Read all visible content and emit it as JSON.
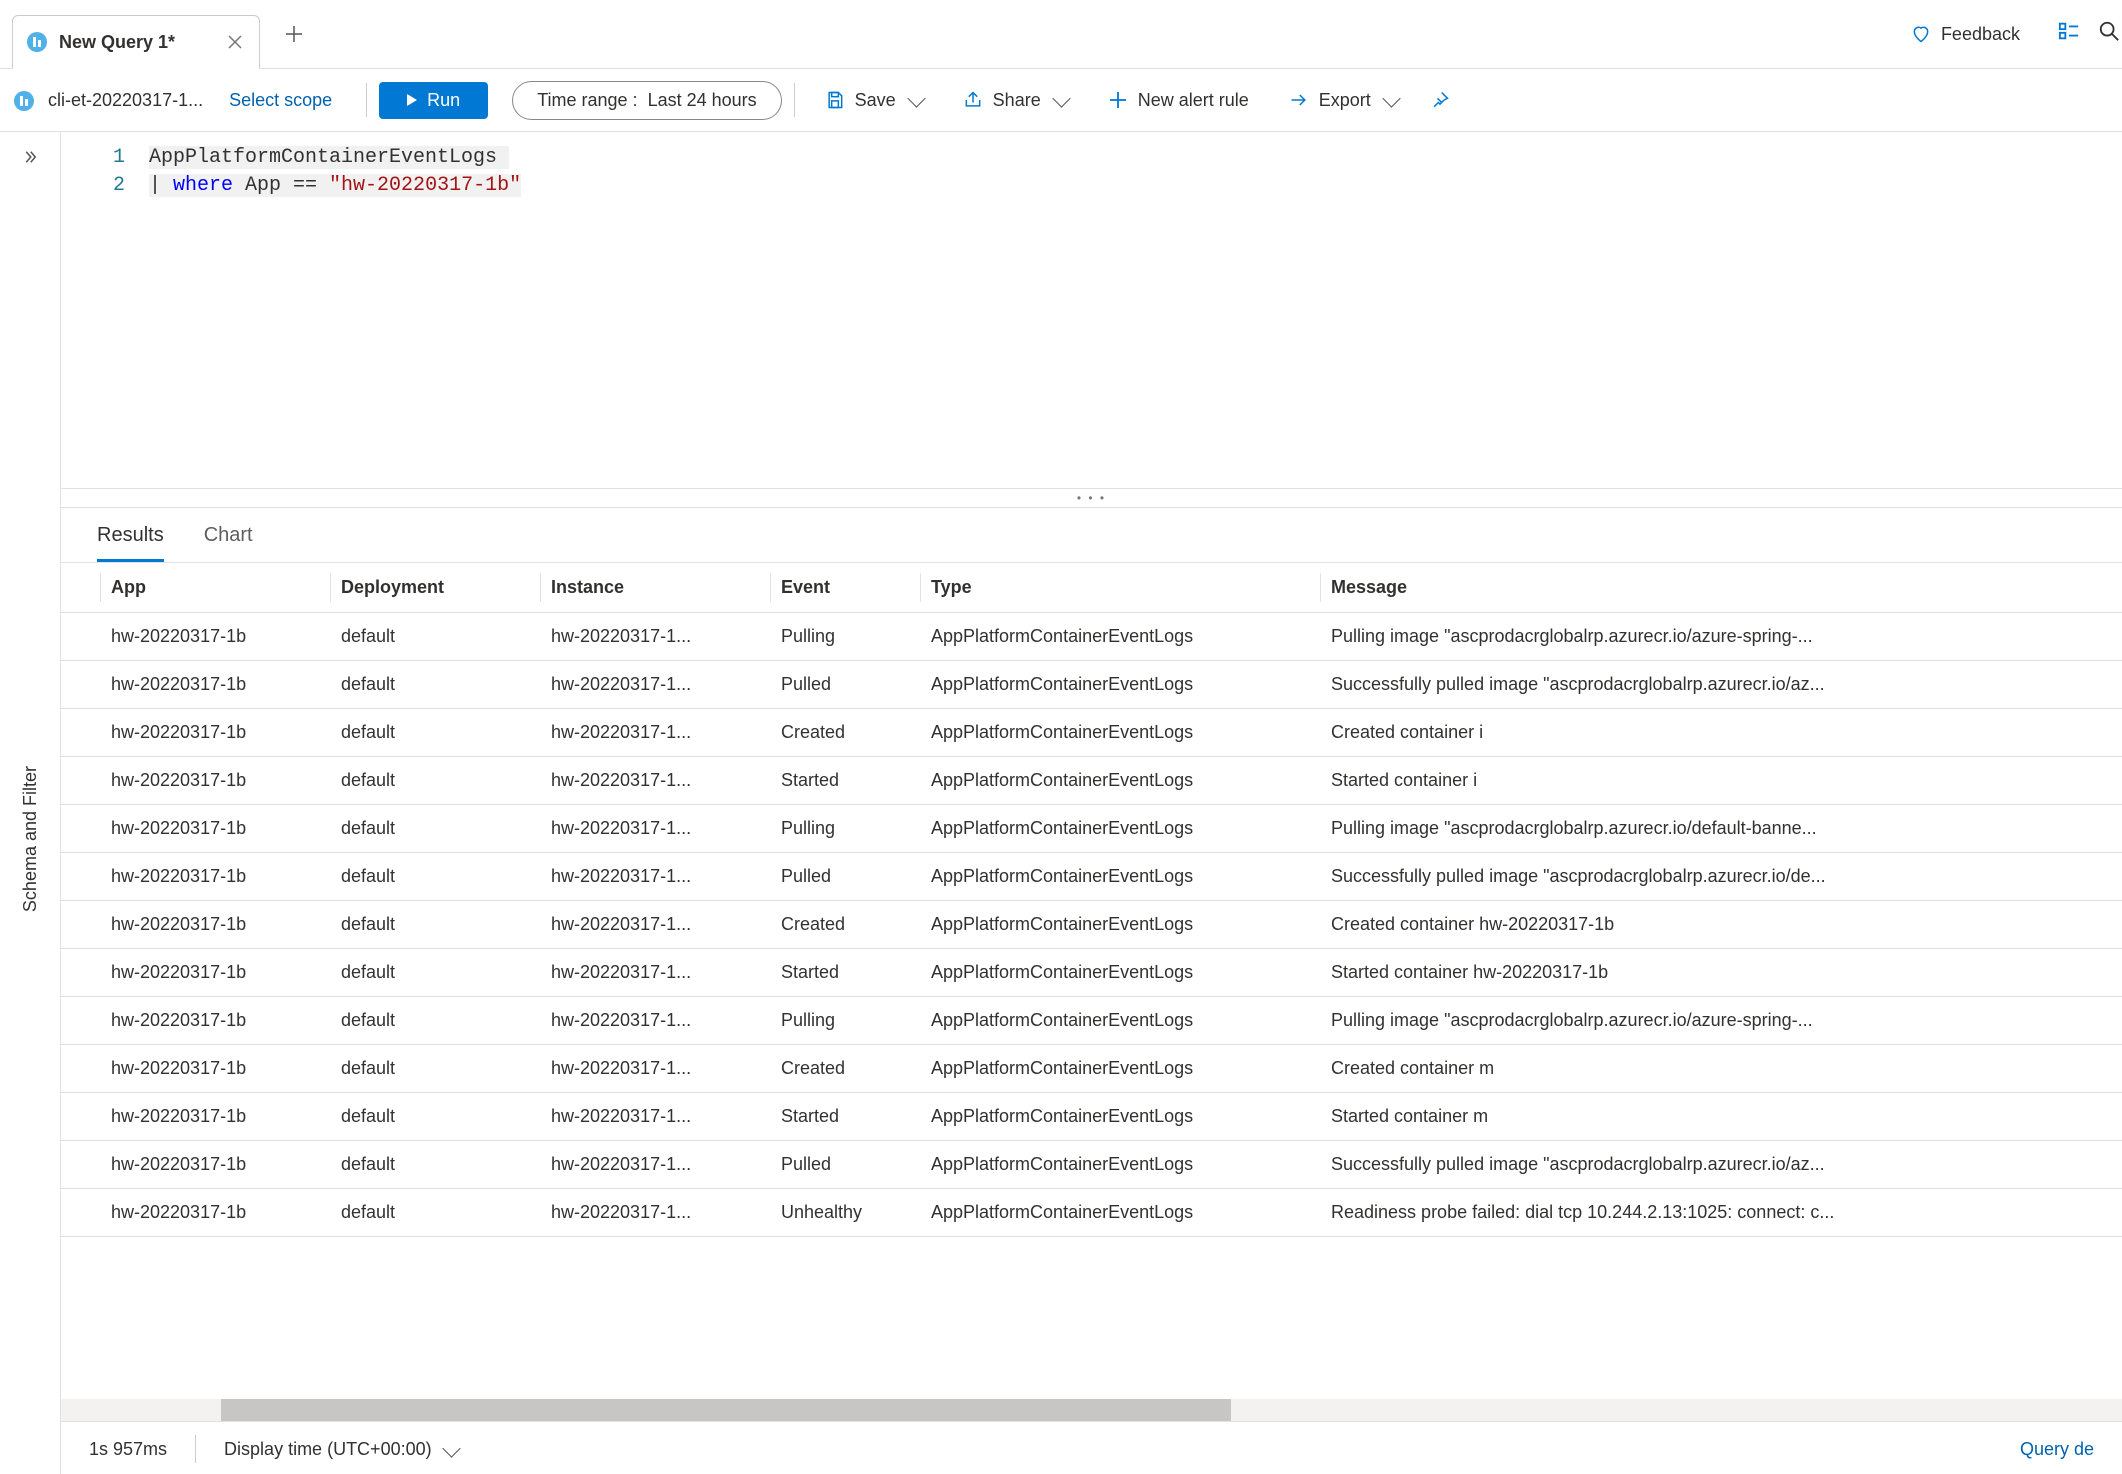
{
  "tabs": {
    "active_title": "New Query 1*"
  },
  "header": {
    "feedback": "Feedback"
  },
  "toolbar": {
    "scope": "cli-et-20220317-1...",
    "select_scope": "Select scope",
    "run": "Run",
    "time_label": "Time range :",
    "time_value": "Last 24 hours",
    "save": "Save",
    "share": "Share",
    "new_alert": "New alert rule",
    "export": "Export"
  },
  "sidebar": {
    "label": "Schema and Filter"
  },
  "editor": {
    "lines": [
      {
        "n": "1",
        "plain": "AppPlatformContainerEventLogs",
        "highlight": true
      },
      {
        "n": "2",
        "prefix": "| ",
        "kw": "where",
        "mid": " App == ",
        "str": "\"hw-20220317-1b\"",
        "highlight": true
      }
    ]
  },
  "results": {
    "tabs": {
      "results": "Results",
      "chart": "Chart"
    },
    "columns": [
      "App",
      "Deployment",
      "Instance",
      "Event",
      "Type",
      "Message"
    ],
    "rows": [
      {
        "app": "hw-20220317-1b",
        "dep": "default",
        "inst": "hw-20220317-1...",
        "evt": "Pulling",
        "type": "AppPlatformContainerEventLogs",
        "msg": "Pulling image \"ascprodacrglobalrp.azurecr.io/azure-spring-..."
      },
      {
        "app": "hw-20220317-1b",
        "dep": "default",
        "inst": "hw-20220317-1...",
        "evt": "Pulled",
        "type": "AppPlatformContainerEventLogs",
        "msg": "Successfully pulled image \"ascprodacrglobalrp.azurecr.io/az..."
      },
      {
        "app": "hw-20220317-1b",
        "dep": "default",
        "inst": "hw-20220317-1...",
        "evt": "Created",
        "type": "AppPlatformContainerEventLogs",
        "msg": "Created container i"
      },
      {
        "app": "hw-20220317-1b",
        "dep": "default",
        "inst": "hw-20220317-1...",
        "evt": "Started",
        "type": "AppPlatformContainerEventLogs",
        "msg": "Started container i"
      },
      {
        "app": "hw-20220317-1b",
        "dep": "default",
        "inst": "hw-20220317-1...",
        "evt": "Pulling",
        "type": "AppPlatformContainerEventLogs",
        "msg": "Pulling image \"ascprodacrglobalrp.azurecr.io/default-banne..."
      },
      {
        "app": "hw-20220317-1b",
        "dep": "default",
        "inst": "hw-20220317-1...",
        "evt": "Pulled",
        "type": "AppPlatformContainerEventLogs",
        "msg": "Successfully pulled image \"ascprodacrglobalrp.azurecr.io/de..."
      },
      {
        "app": "hw-20220317-1b",
        "dep": "default",
        "inst": "hw-20220317-1...",
        "evt": "Created",
        "type": "AppPlatformContainerEventLogs",
        "msg": "Created container hw-20220317-1b"
      },
      {
        "app": "hw-20220317-1b",
        "dep": "default",
        "inst": "hw-20220317-1...",
        "evt": "Started",
        "type": "AppPlatformContainerEventLogs",
        "msg": "Started container hw-20220317-1b"
      },
      {
        "app": "hw-20220317-1b",
        "dep": "default",
        "inst": "hw-20220317-1...",
        "evt": "Pulling",
        "type": "AppPlatformContainerEventLogs",
        "msg": "Pulling image \"ascprodacrglobalrp.azurecr.io/azure-spring-..."
      },
      {
        "app": "hw-20220317-1b",
        "dep": "default",
        "inst": "hw-20220317-1...",
        "evt": "Created",
        "type": "AppPlatformContainerEventLogs",
        "msg": "Created container m"
      },
      {
        "app": "hw-20220317-1b",
        "dep": "default",
        "inst": "hw-20220317-1...",
        "evt": "Started",
        "type": "AppPlatformContainerEventLogs",
        "msg": "Started container m"
      },
      {
        "app": "hw-20220317-1b",
        "dep": "default",
        "inst": "hw-20220317-1...",
        "evt": "Pulled",
        "type": "AppPlatformContainerEventLogs",
        "msg": "Successfully pulled image \"ascprodacrglobalrp.azurecr.io/az..."
      },
      {
        "app": "hw-20220317-1b",
        "dep": "default",
        "inst": "hw-20220317-1...",
        "evt": "Unhealthy",
        "type": "AppPlatformContainerEventLogs",
        "msg": "Readiness probe failed: dial tcp 10.244.2.13:1025: connect: c..."
      }
    ]
  },
  "status": {
    "duration": "1s 957ms",
    "display_time": "Display time (UTC+00:00)",
    "query_details": "Query de"
  }
}
